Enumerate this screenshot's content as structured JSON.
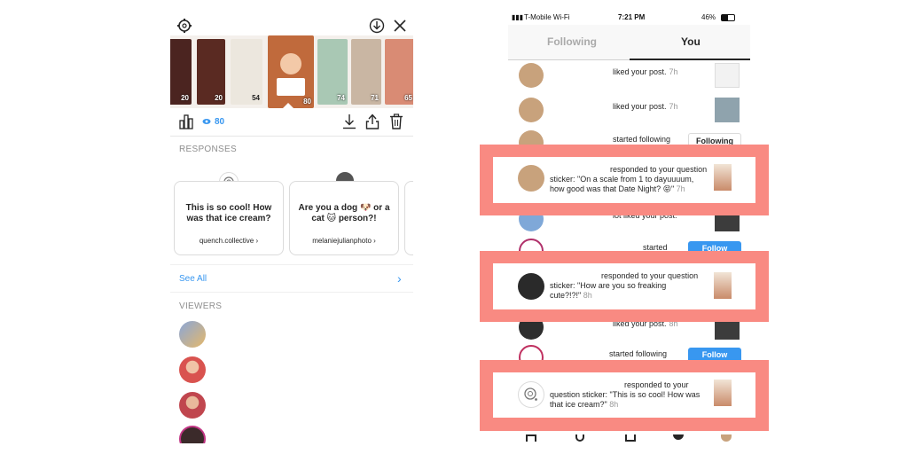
{
  "left_panel": {
    "viewer_count": "80",
    "responses_header": "RESPONSES",
    "viewers_header": "VIEWERS",
    "see_all_label": "See All",
    "story_thumbs": [
      {
        "count": "20",
        "color": "#5a2a22"
      },
      {
        "count": "20",
        "color": "#5a2a22"
      },
      {
        "count": "54",
        "color": "#e9e4dc"
      },
      {
        "count": "80",
        "color": "#c06a3c"
      },
      {
        "count": "74",
        "color": "#a9c8b4"
      },
      {
        "count": "71",
        "color": "#c9b6a3"
      },
      {
        "count": "65",
        "color": "#d98b74"
      }
    ],
    "responses": [
      {
        "question": "This is so cool! How was that ice cream?",
        "username": "quench.collective"
      },
      {
        "question": "Are you a dog 🐶 or a cat 🐱 person?!",
        "username": "melaniejulianphoto"
      }
    ],
    "viewer_colors": [
      "#8aa6d8",
      "#d9534f",
      "#c0464e",
      "#3b2a2a"
    ]
  },
  "right_panel": {
    "status_bar": {
      "carrier": "T-Mobile Wi-Fi",
      "time": "7:21 PM",
      "battery": "46%"
    },
    "tabs": [
      {
        "label": "Following"
      },
      {
        "label": "You"
      }
    ],
    "rows": [
      {
        "text": "liked your post.",
        "time": "7h",
        "avatar_color": "#c8a27c",
        "post_color": "#f2f2f2"
      },
      {
        "text": "liked your post.",
        "time": "7h",
        "avatar_color": "#c8a27c",
        "post_color": "#8fa3ad"
      },
      {
        "text": "started following",
        "button": "Following",
        "avatar_color": "#c8a27c"
      },
      {
        "text": "lot liked your post.",
        "avatar_color": "#7fa8d8",
        "post_color": "#3c3c3c"
      },
      {
        "text": "started",
        "button": "Follow",
        "avatar_color": "#b0306a"
      },
      {
        "text": "liked your post.",
        "time": "8h",
        "avatar_color": "#2e2e2e",
        "post_color": "#3c3c3c"
      },
      {
        "text": "started following",
        "button": "Follow",
        "avatar_color": "#c03060"
      }
    ],
    "highlights": [
      {
        "line1": "responded to your question",
        "line2": "sticker: \"On a scale from 1 to dayuuuum,",
        "line3": "how good was that Date Night? 😝\"",
        "time": "7h",
        "avatar_color": "#c8a27c"
      },
      {
        "line1": "responded to your question",
        "line2": "sticker: \"How are you so freaking",
        "line3": "cute?!?!\"",
        "time": "8h",
        "avatar_color": "#2a2a2a"
      },
      {
        "line1": "responded to your",
        "line2": "question sticker: \"This is so cool! How was",
        "line3": "that ice cream?\"",
        "time": "8h",
        "avatar_color": "#ffffff"
      }
    ]
  },
  "colors": {
    "highlight": "#f98a82",
    "link_blue": "#3897f0"
  }
}
